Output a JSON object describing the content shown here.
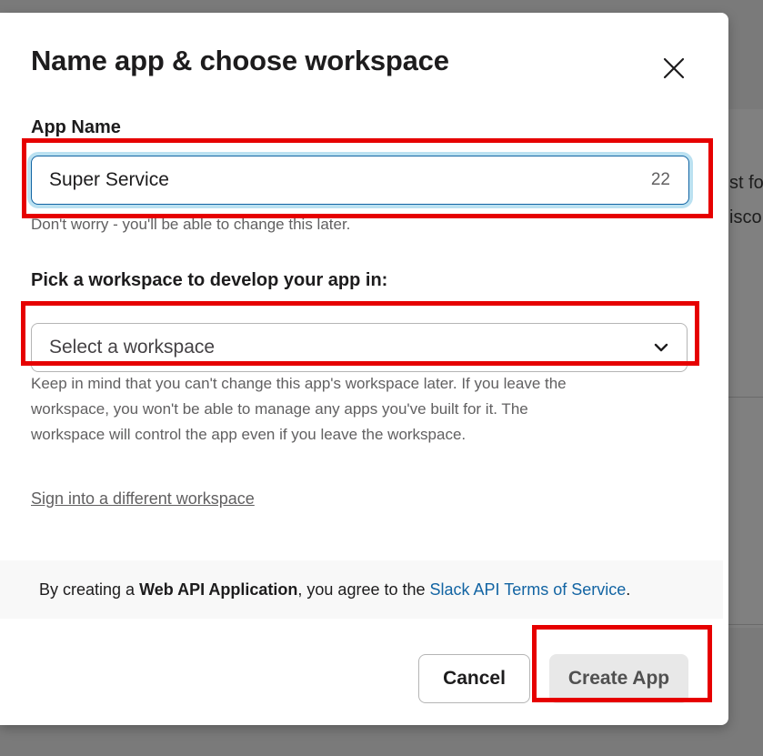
{
  "background": {
    "text_line1": "st fo",
    "text_line2": "isco"
  },
  "dialog": {
    "title": "Name app & choose workspace",
    "close_icon": "close-icon",
    "app_name": {
      "label": "App Name",
      "value": "Super Service",
      "char_count": "22",
      "hint": "Don't worry - you'll be able to change this later."
    },
    "workspace": {
      "label": "Pick a workspace to develop your app in:",
      "selected": "Select a workspace",
      "chevron_icon": "chevron-down-icon",
      "hint_line1": "Keep in mind that you can't change this app's workspace later. If you leave the",
      "hint_line2": "workspace, you won't be able to manage any apps you've built for it. The",
      "hint_line3": "workspace will control the app even if you leave the workspace."
    },
    "sign_in_link": "Sign into a different workspace",
    "terms": {
      "prefix": "By creating a ",
      "app_type": "Web API Application",
      "middle": ", you agree to the ",
      "link": "Slack API Terms of Service",
      "suffix": "."
    },
    "buttons": {
      "cancel": "Cancel",
      "create": "Create App"
    }
  },
  "colors": {
    "highlight": "#e60000",
    "link": "#1264a3",
    "focus_border": "#1264a3"
  }
}
